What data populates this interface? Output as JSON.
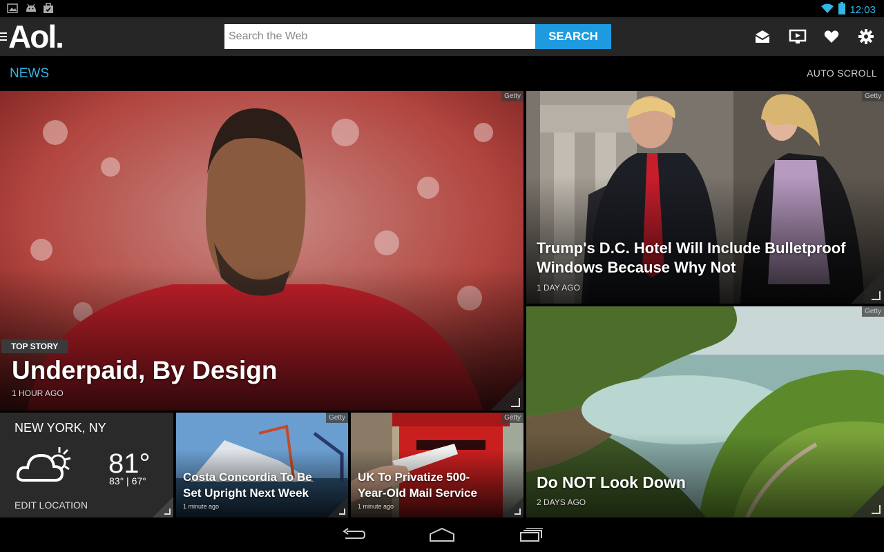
{
  "status_bar": {
    "time": "12:03",
    "left_icons": [
      "gallery-icon",
      "android-icon",
      "briefcase-icon"
    ],
    "right_icons": [
      "wifi-icon",
      "battery-icon"
    ]
  },
  "app_bar": {
    "logo": "Aol.",
    "search": {
      "placeholder": "Search the Web",
      "value": "",
      "button_label": "SEARCH"
    },
    "tools": [
      "mail-icon",
      "video-icon",
      "heart-icon",
      "gear-icon"
    ]
  },
  "section": {
    "label": "NEWS",
    "auto_scroll_label": "AUTO SCROLL"
  },
  "tiles": {
    "top_story": {
      "badge": "TOP STORY",
      "headline": "Underpaid, By Design",
      "age": "1 HOUR AGO",
      "credit": "Getty"
    },
    "trump": {
      "headline_line1": "Trump's D.C. Hotel Will Include Bulletproof",
      "headline_line2": "Windows Because Why Not",
      "age": "1 DAY AGO",
      "credit": "Getty"
    },
    "look_down": {
      "headline": "Do NOT Look Down",
      "age": "2 DAYS AGO",
      "credit": "Getty"
    },
    "weather": {
      "city": "NEW YORK, NY",
      "temp": "81°",
      "hilo": "83° | 67°",
      "edit_label": "EDIT LOCATION"
    },
    "costa": {
      "headline_line1": "Costa Concordia To Be",
      "headline_line2": "Set Upright Next Week",
      "age": "1 minute ago",
      "credit": "Getty"
    },
    "uk": {
      "headline_line1": "UK To Privatize 500-",
      "headline_line2": "Year-Old Mail Service",
      "age": "1 minute ago",
      "credit": "Getty"
    }
  },
  "nav_bar": [
    "back-icon",
    "home-icon",
    "recent-apps-icon"
  ]
}
